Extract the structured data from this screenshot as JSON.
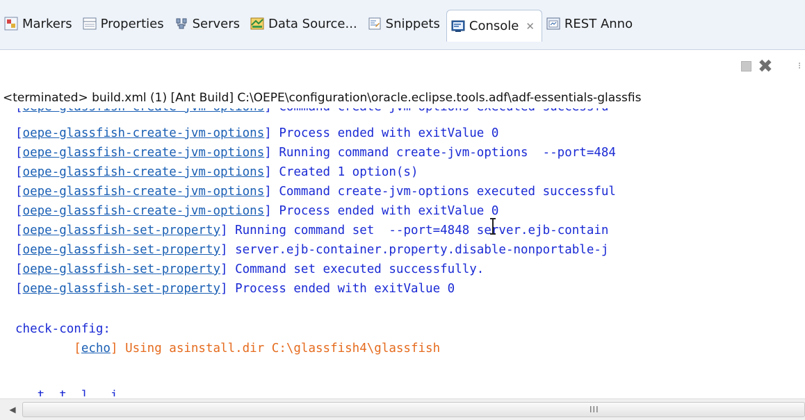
{
  "tabs": [
    {
      "label": "Markers",
      "icon": "markers-icon",
      "active": false
    },
    {
      "label": "Properties",
      "icon": "properties-icon",
      "active": false
    },
    {
      "label": "Servers",
      "icon": "servers-icon",
      "active": false
    },
    {
      "label": "Data Source...",
      "icon": "data-source-icon",
      "active": false
    },
    {
      "label": "Snippets",
      "icon": "snippets-icon",
      "active": false
    },
    {
      "label": "Console",
      "icon": "console-icon",
      "active": true,
      "close": "✕"
    },
    {
      "label": "REST Anno",
      "icon": "rest-icon",
      "active": false
    }
  ],
  "toolbar": {
    "stop_icon": "terminate-icon",
    "remove_icon": "remove-launch-icon",
    "remove_glyph": "✖",
    "more_glyph": "⁝"
  },
  "terminated_line": "<terminated> build.xml (1) [Ant Build] C:\\OEPE\\configuration\\oracle.eclipse.tools.adf\\adf-essentials-glassfis",
  "console": {
    "cut_line": {
      "task": "oepe-glassfish-create-jvm-options",
      "text": " Command create-jvm-options executed successfu"
    },
    "lines": [
      {
        "task": "oepe-glassfish-create-jvm-options",
        "text": " Process ended with exitValue 0"
      },
      {
        "task": "oepe-glassfish-create-jvm-options",
        "text": " Running command create-jvm-options  --port=484"
      },
      {
        "task": "oepe-glassfish-create-jvm-options",
        "text": " Created 1 option(s)"
      },
      {
        "task": "oepe-glassfish-create-jvm-options",
        "text": " Command create-jvm-options executed successful"
      },
      {
        "task": "oepe-glassfish-create-jvm-options",
        "text": " Process ended with exitValue 0"
      },
      {
        "task": "oepe-glassfish-set-property",
        "text": " Running command set  --port=4848 server.ejb-contain"
      },
      {
        "task": "oepe-glassfish-set-property",
        "text": " server.ejb-container.property.disable-nonportable-j"
      },
      {
        "task": "oepe-glassfish-set-property",
        "text": " Command set executed successfully."
      },
      {
        "task": "oepe-glassfish-set-property",
        "text": " Process ended with exitValue 0"
      }
    ],
    "target": "check-config:",
    "echo_task": "echo",
    "echo_text": " Using asinstall.dir C:\\glassfish4\\glassfish",
    "partial_line": "   t  t  l   i"
  },
  "scrollbar": {
    "grip": "III",
    "left_arrow": "◀"
  },
  "colors": {
    "task_link": "#1a5fb4",
    "output": "#1a2ad4",
    "echo": "#e56b1e",
    "tabbar": "#eef3fa"
  }
}
